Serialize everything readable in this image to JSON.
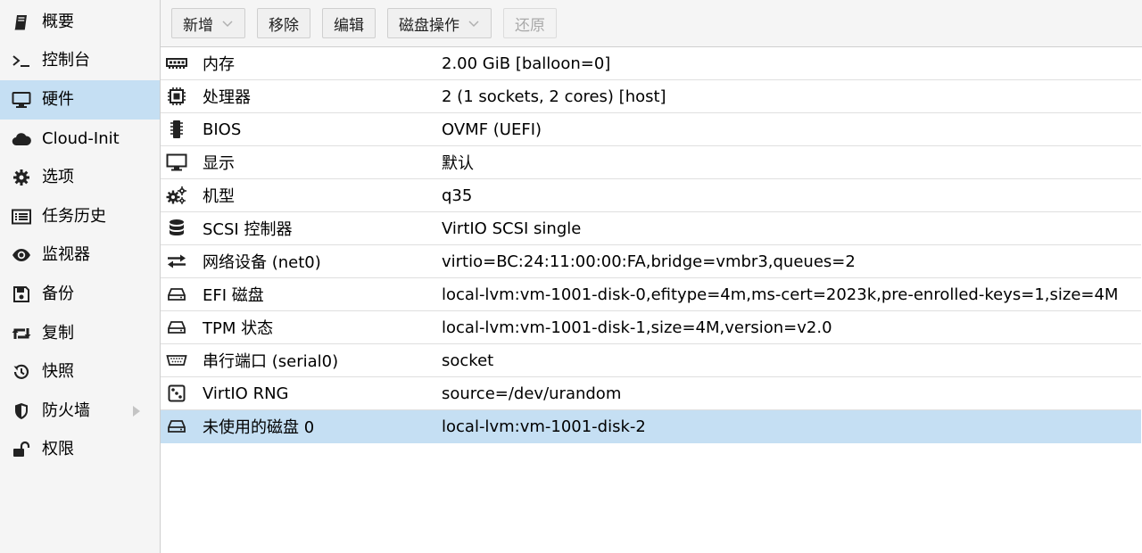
{
  "sidebar": {
    "items": [
      {
        "label": "概要",
        "icon": "book-icon"
      },
      {
        "label": "控制台",
        "icon": "terminal-icon"
      },
      {
        "label": "硬件",
        "icon": "desktop-icon"
      },
      {
        "label": "Cloud-Init",
        "icon": "cloud-icon"
      },
      {
        "label": "选项",
        "icon": "gear-icon"
      },
      {
        "label": "任务历史",
        "icon": "list-icon"
      },
      {
        "label": "监视器",
        "icon": "eye-icon"
      },
      {
        "label": "备份",
        "icon": "floppy-icon"
      },
      {
        "label": "复制",
        "icon": "retweet-icon"
      },
      {
        "label": "快照",
        "icon": "history-icon"
      },
      {
        "label": "防火墙",
        "icon": "shield-icon"
      },
      {
        "label": "权限",
        "icon": "unlock-icon"
      }
    ],
    "active_index": 2
  },
  "toolbar": {
    "add_label": "新增",
    "remove_label": "移除",
    "edit_label": "编辑",
    "disk_action_label": "磁盘操作",
    "revert_label": "还原"
  },
  "hardware": [
    {
      "name": "内存",
      "value": "2.00 GiB [balloon=0]",
      "icon": "memory-icon"
    },
    {
      "name": "处理器",
      "value": "2 (1 sockets, 2 cores) [host]",
      "icon": "cpu-icon"
    },
    {
      "name": "BIOS",
      "value": "OVMF (UEFI)",
      "icon": "microchip-icon"
    },
    {
      "name": "显示",
      "value": "默认",
      "icon": "desktop-icon"
    },
    {
      "name": "机型",
      "value": "q35",
      "icon": "cogs-icon"
    },
    {
      "name": "SCSI 控制器",
      "value": "VirtIO SCSI single",
      "icon": "database-icon"
    },
    {
      "name": "网络设备 (net0)",
      "value": "virtio=BC:24:11:00:00:FA,bridge=vmbr3,queues=2",
      "icon": "exchange-icon"
    },
    {
      "name": "EFI 磁盘",
      "value": "local-lvm:vm-1001-disk-0,efitype=4m,ms-cert=2023k,pre-enrolled-keys=1,size=4M",
      "icon": "hdd-icon"
    },
    {
      "name": "TPM 状态",
      "value": "local-lvm:vm-1001-disk-1,size=4M,version=v2.0",
      "icon": "hdd-icon"
    },
    {
      "name": "串行端口 (serial0)",
      "value": "socket",
      "icon": "serial-port-icon"
    },
    {
      "name": "VirtIO RNG",
      "value": "source=/dev/urandom",
      "icon": "dice-icon"
    },
    {
      "name": "未使用的磁盘 0",
      "value": "local-lvm:vm-1001-disk-2",
      "icon": "hdd-icon"
    }
  ],
  "selected_row_index": 11,
  "colors": {
    "selection": "#c5dff3",
    "sidebar_bg": "#f5f5f5",
    "border": "#cfcfcf"
  }
}
